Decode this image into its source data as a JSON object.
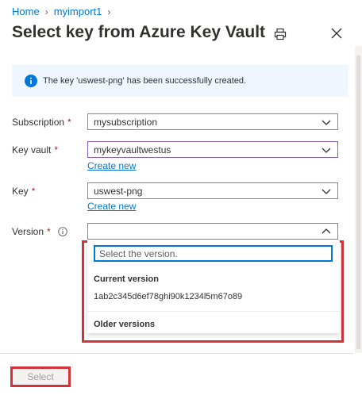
{
  "breadcrumb": {
    "items": [
      "Home",
      "myimport1"
    ]
  },
  "header": {
    "title": "Select key from Azure Key Vault"
  },
  "banner": {
    "message": "The key 'uswest-png' has been successfully created."
  },
  "form": {
    "subscription": {
      "label": "Subscription",
      "value": "mysubscription"
    },
    "key_vault": {
      "label": "Key vault",
      "value": "mykeyvaultwestus",
      "create_new": "Create new"
    },
    "key": {
      "label": "Key",
      "value": "uswest-png",
      "create_new": "Create new"
    },
    "version": {
      "label": "Version",
      "value": ""
    }
  },
  "required_marker": "*",
  "version_panel": {
    "search_placeholder": "Select the version.",
    "current_heading": "Current version",
    "current_option": "1ab2c345d6ef78ghi90k1234l5m67o89",
    "older_heading": "Older versions"
  },
  "footer": {
    "select_label": "Select"
  },
  "colors": {
    "accent": "#0078d4",
    "required": "#a4262c",
    "highlight": "#d13438",
    "banner_bg": "#f0f6ff"
  }
}
